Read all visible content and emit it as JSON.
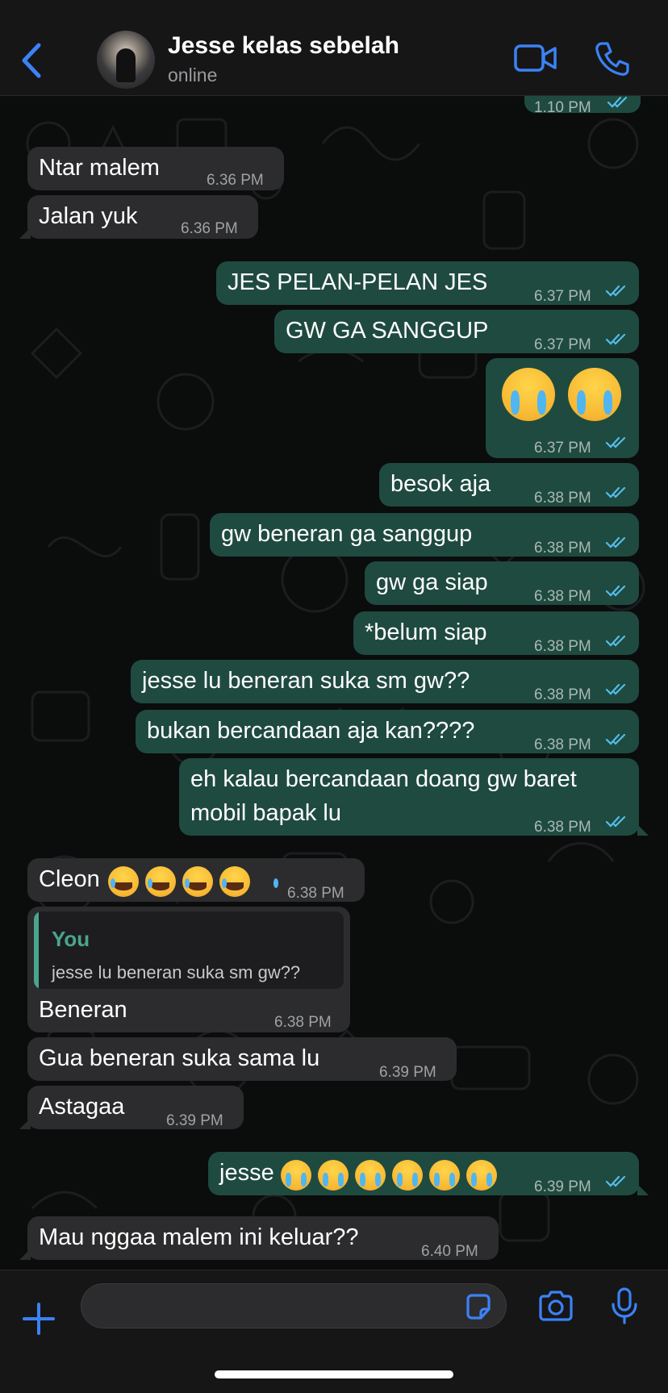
{
  "header": {
    "contact_name": "Jesse kelas sebelah",
    "status": "online"
  },
  "colors": {
    "incoming_bubble": "#2c2c2e",
    "outgoing_bubble": "#1f4a3f",
    "accent": "#3b82f6",
    "read_tick": "#53bdeb"
  },
  "icons": {
    "back": "chevron-left-icon",
    "video": "video-camera-icon",
    "call": "phone-icon",
    "attach": "plus-icon",
    "sticker": "sticker-icon",
    "camera": "camera-icon",
    "mic": "microphone-icon",
    "read_receipt": "double-check-icon"
  },
  "messages": [
    {
      "dir": "out",
      "text": "",
      "time": "1.10 PM",
      "read": true
    },
    {
      "dir": "in",
      "text": "Ntar malem",
      "time": "6.36 PM"
    },
    {
      "dir": "in",
      "text": "Jalan yuk",
      "time": "6.36 PM"
    },
    {
      "dir": "out",
      "text": "JES PELAN-PELAN JES",
      "time": "6.37 PM",
      "read": true
    },
    {
      "dir": "out",
      "text": "GW GA SANGGUP",
      "time": "6.37 PM",
      "read": true
    },
    {
      "dir": "out",
      "text": "😭 😭",
      "emoji": [
        "loudly-crying-face",
        "loudly-crying-face"
      ],
      "time": "6.37 PM",
      "read": true
    },
    {
      "dir": "out",
      "text": "besok aja",
      "time": "6.38 PM",
      "read": true
    },
    {
      "dir": "out",
      "text": "gw beneran ga sanggup",
      "time": "6.38 PM",
      "read": true
    },
    {
      "dir": "out",
      "text": "gw ga siap",
      "time": "6.38 PM",
      "read": true
    },
    {
      "dir": "out",
      "text": "*belum siap",
      "time": "6.38 PM",
      "read": true
    },
    {
      "dir": "out",
      "text": "jesse lu beneran suka sm gw??",
      "time": "6.38 PM",
      "read": true
    },
    {
      "dir": "out",
      "text": "bukan bercandaan aja kan????",
      "time": "6.38 PM",
      "read": true
    },
    {
      "dir": "out",
      "text_line1": "eh kalau bercandaan doang gw baret",
      "text_line2": "mobil bapak lu",
      "time": "6.38 PM",
      "read": true
    },
    {
      "dir": "in",
      "text": "Cleon",
      "emoji": [
        "face-with-tears-of-joy",
        "face-with-tears-of-joy",
        "face-with-tears-of-joy",
        "face-with-tears-of-joy"
      ],
      "time": "6.38 PM"
    },
    {
      "dir": "in",
      "quote_author": "You",
      "quote_text": "jesse lu beneran suka sm gw??",
      "text": "Beneran",
      "time": "6.38 PM"
    },
    {
      "dir": "in",
      "text": "Gua beneran suka sama lu",
      "time": "6.39 PM"
    },
    {
      "dir": "in",
      "text": "Astagaa",
      "time": "6.39 PM"
    },
    {
      "dir": "out",
      "text": "jesse",
      "emoji": [
        "loudly-crying-face",
        "loudly-crying-face",
        "loudly-crying-face",
        "loudly-crying-face",
        "loudly-crying-face",
        "loudly-crying-face"
      ],
      "time": "6.39 PM",
      "read": true
    },
    {
      "dir": "in",
      "text": "Mau nggaa malem ini keluar??",
      "time": "6.40 PM"
    }
  ],
  "composer": {
    "value": "",
    "placeholder": ""
  }
}
